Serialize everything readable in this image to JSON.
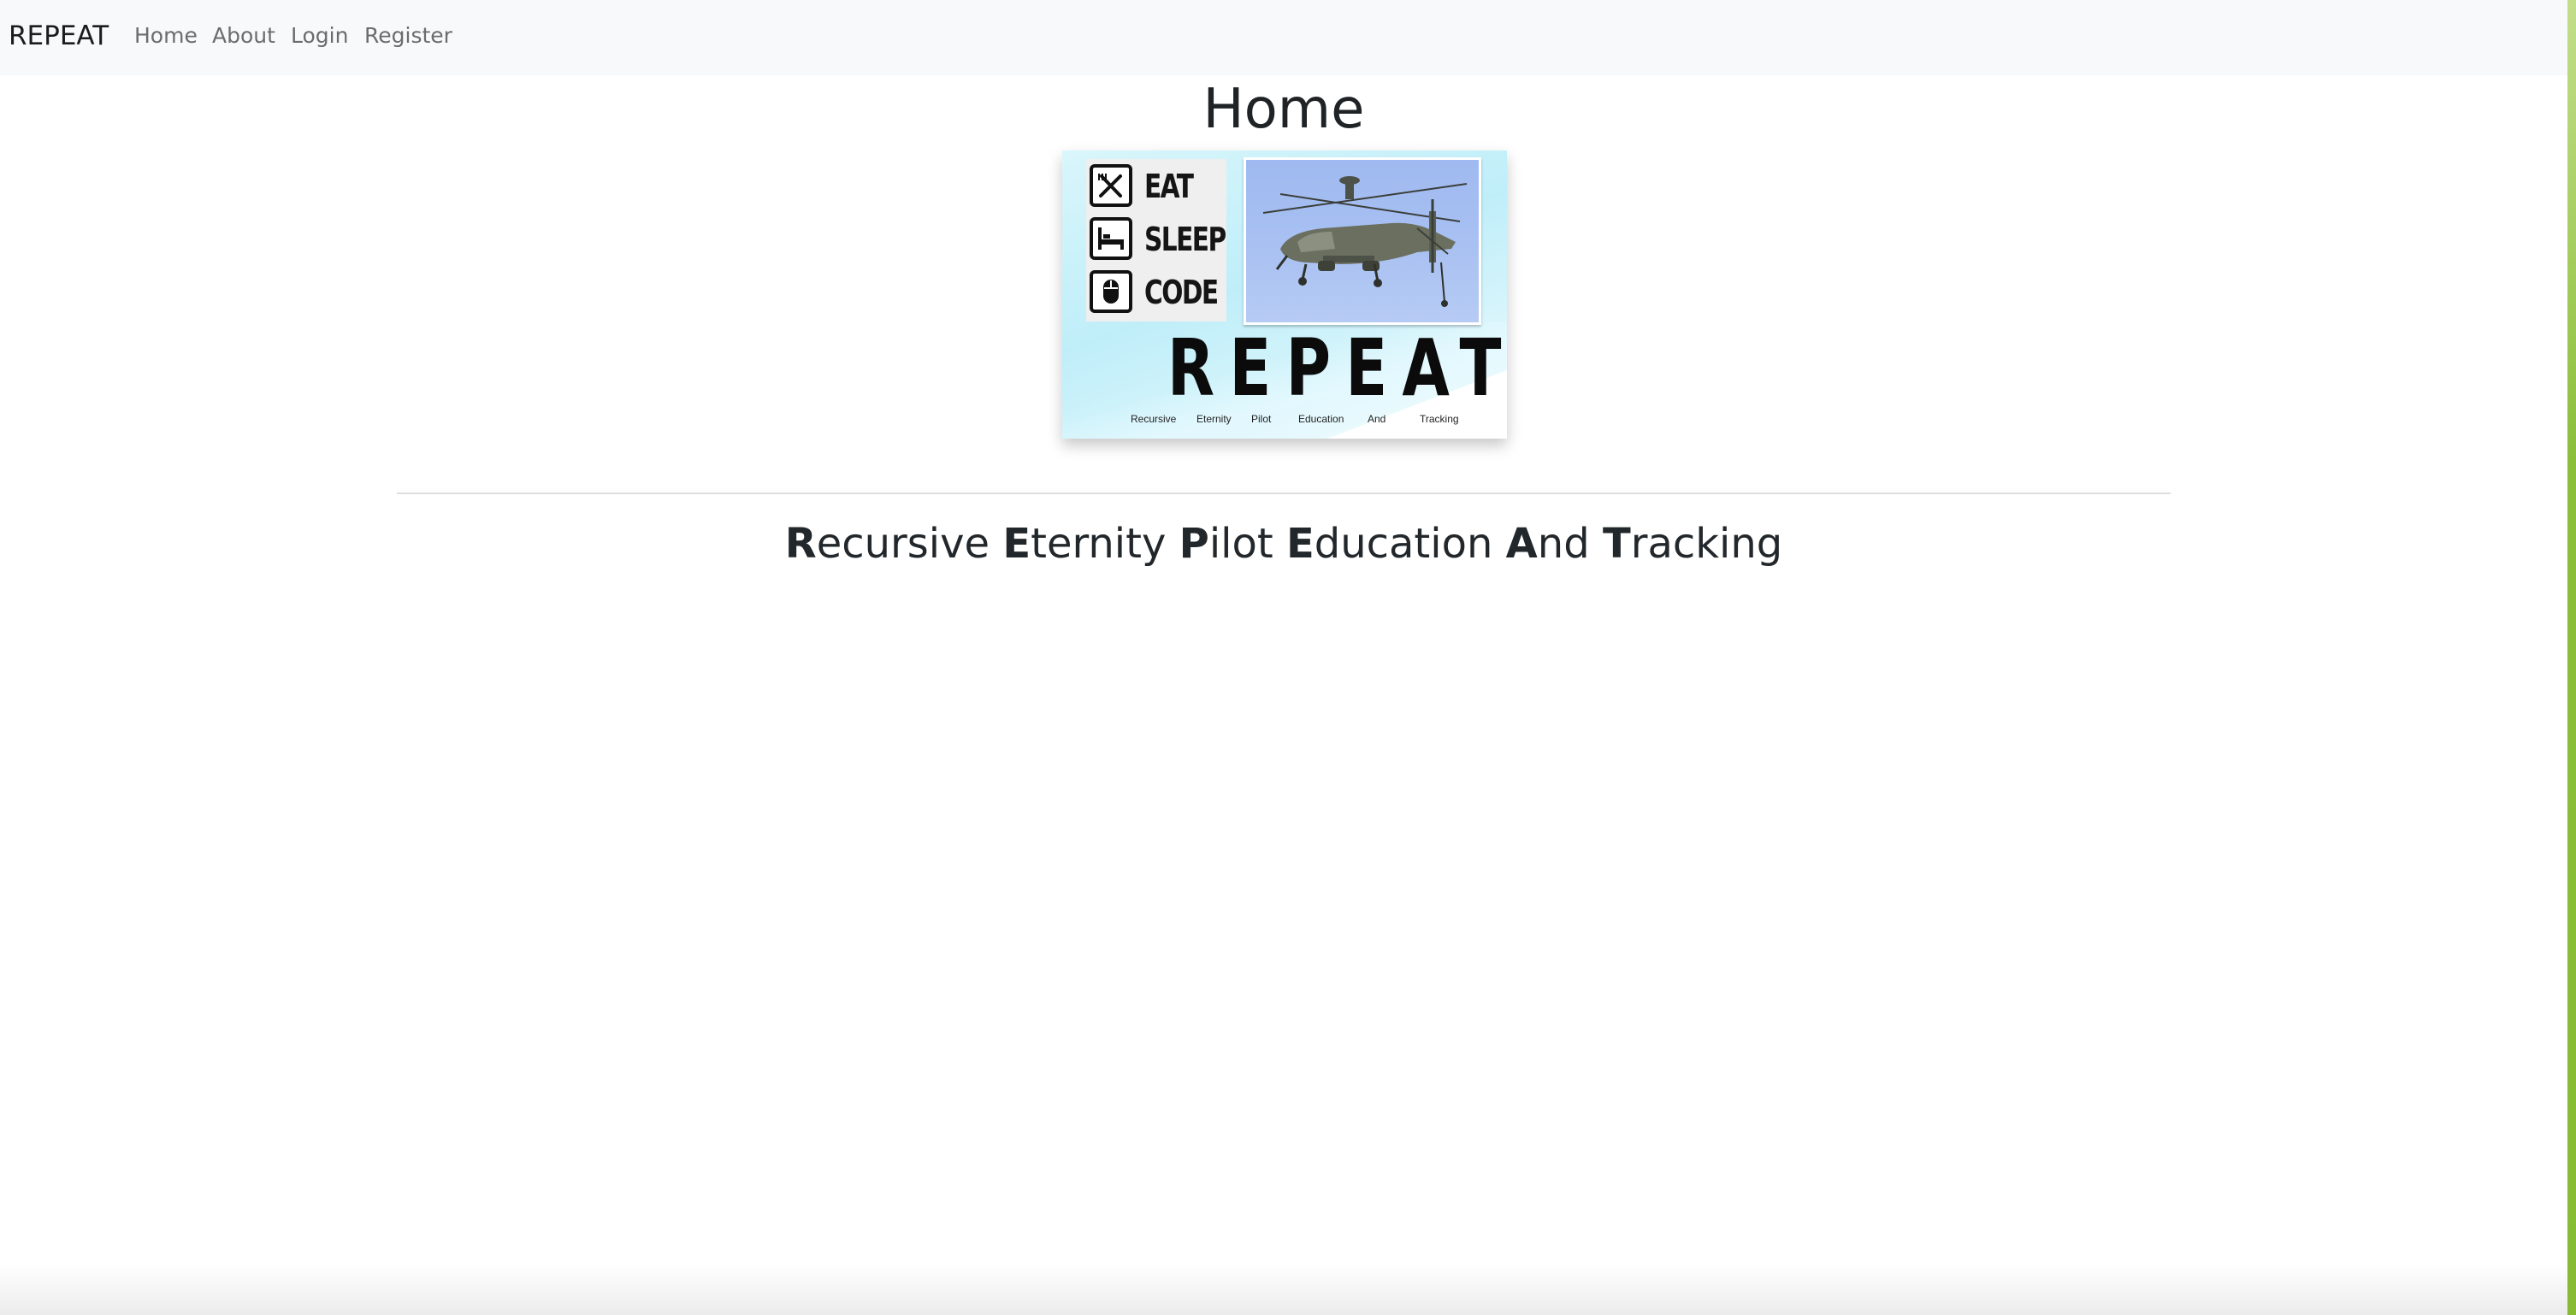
{
  "navbar": {
    "brand": "REPEAT",
    "links": [
      {
        "label": "Home"
      },
      {
        "label": "About"
      },
      {
        "label": "Login"
      },
      {
        "label": "Register"
      }
    ]
  },
  "main": {
    "title": "Home",
    "banner": {
      "checklist": [
        "EAT",
        "SLEEP",
        "CODE"
      ],
      "checklist_icons": [
        "utensils-icon",
        "bed-icon",
        "mouse-icon"
      ],
      "image_subject": "helicopter",
      "acronym": "REPEAT",
      "words": [
        "Recursive",
        "Eternity",
        "Pilot",
        "Education",
        "And",
        "Tracking"
      ]
    },
    "subtitle": {
      "parts": [
        {
          "initial": "R",
          "rest": "ecursive"
        },
        {
          "initial": "E",
          "rest": "ternity"
        },
        {
          "initial": "P",
          "rest": "ilot"
        },
        {
          "initial": "E",
          "rest": "ducation"
        },
        {
          "initial": "A",
          "rest": "nd"
        },
        {
          "initial": "T",
          "rest": "racking"
        }
      ]
    }
  },
  "colors": {
    "navbar_bg": "#f8f9fa",
    "nav_link": "#6c6c6c",
    "text": "#212529",
    "accent_strip": "#86bb33"
  }
}
